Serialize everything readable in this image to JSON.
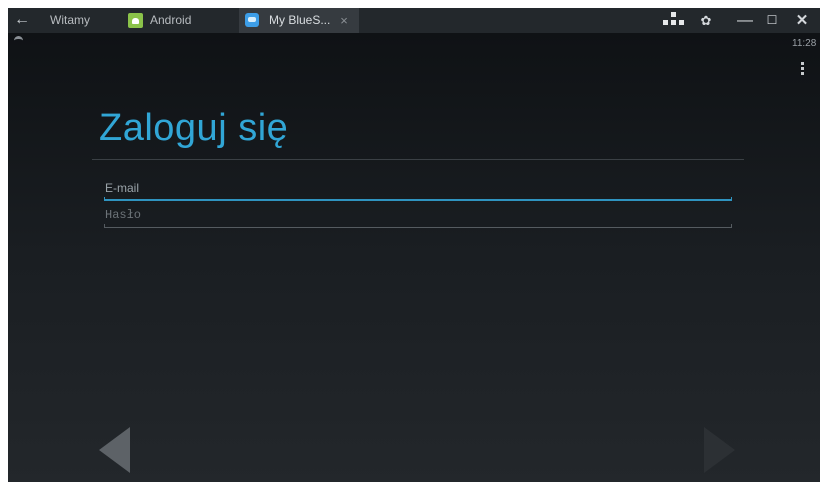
{
  "titlebar": {
    "tabs": [
      {
        "label": "Witamy"
      },
      {
        "label": "Android"
      },
      {
        "label": "My BlueS..."
      }
    ]
  },
  "status": {
    "time": "11:28"
  },
  "login": {
    "title": "Zaloguj się",
    "email_placeholder": "E-mail",
    "password_placeholder": "Hasło"
  },
  "colors": {
    "accent": "#31a6d6",
    "background": "#0a0c0e",
    "titlebar": "#23282c"
  }
}
